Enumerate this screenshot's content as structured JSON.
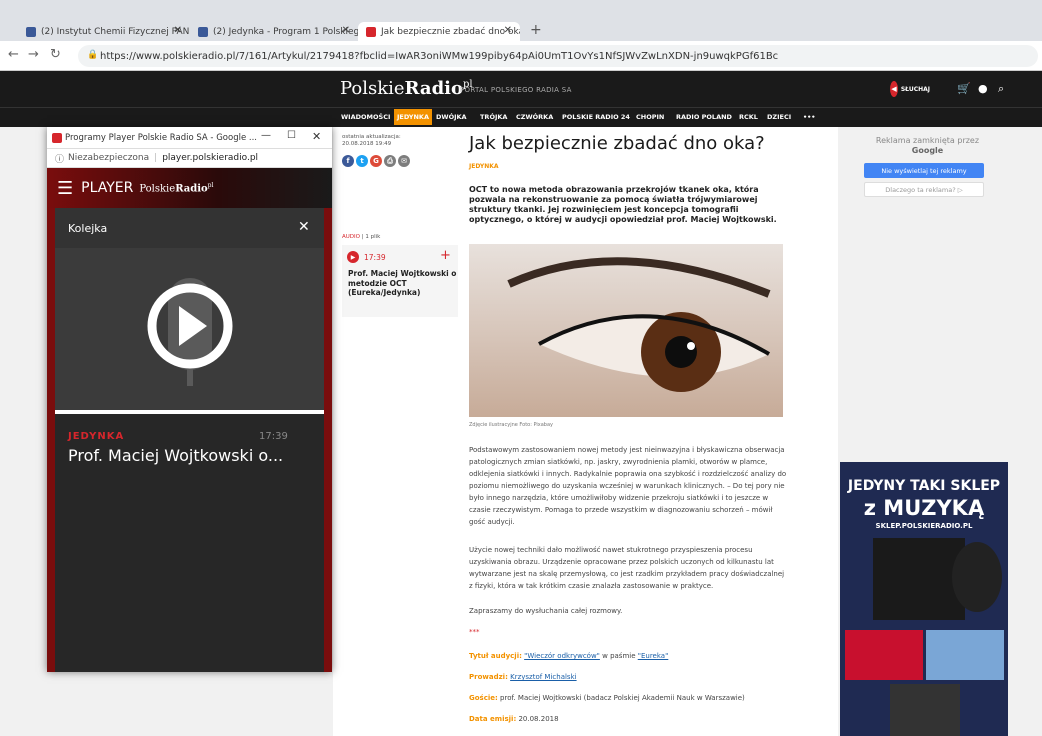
{
  "browser": {
    "tabs": [
      {
        "label": "(2) Instytut Chemii Fizycznej PAN",
        "favicon": "facebook-icon"
      },
      {
        "label": "(2) Jedynka - Program 1 Polskieg",
        "favicon": "facebook-icon"
      },
      {
        "label": "Jak bezpiecznie zbadać dno oka? ",
        "favicon": "polskieradio-icon"
      }
    ],
    "url": "https://www.polskieradio.pl/7/161/Artykul/2179418?fbclid=IwAR3oniWMw199piby64pAi0UmT1OvYs1NfSJWvZwLnXDN-jn9uwqkPGf61Bc"
  },
  "site": {
    "logo_a": "Polskie",
    "logo_b": "Radio",
    "logo_sup": "pl",
    "portal": "PORTAL POLSKIEGO RADIA SA",
    "listen": "SŁUCHAJ",
    "menu": [
      "WIADOMOŚCI",
      "JEDYNKA",
      "DWÓJKA",
      "TRÓJKA",
      "CZWÓRKA",
      "POLSKIE RADIO 24",
      "CHOPIN",
      "RADIO POLAND",
      "RCKL",
      "DZIECI",
      "•••"
    ]
  },
  "side": {
    "updated_label": "ostatnia aktualizacja:",
    "updated_date": "20.08.2018 19:49",
    "audio_label": "AUDIO",
    "files": "1 plik",
    "audio_time": "17:39",
    "audio_title": "Prof. Maciej Wojtkowski o metodzie OCT (Eureka/Jedynka)"
  },
  "article": {
    "title": "Jak bezpiecznie zbadać dno oka?",
    "category": "JEDYNKA",
    "lead": "OCT to nowa metoda obrazowania przekrojów tkanek oka, która pozwala na rekonstruowanie za pomocą światła trójwymiarowej struktury tkanki. Jej rozwinięciem jest koncepcja tomografii optycznego, o której w audycji opowiedział prof. Maciej Wojtkowski.",
    "caption": "Zdjęcie ilustracyjne   Foto: Pixabay",
    "p1": "Podstawowym zastosowaniem nowej metody jest nieinwazyjna i błyskawiczna obserwacja patologicznych zmian siatkówki, np. jaskry, zwyrodnienia plamki, otworów w plamce, odklejenia siatkówki i innych. Radykalnie poprawia ona szybkość i rozdzielczość analizy do poziomu niemożliwego do uzyskania wcześniej w warunkach klinicznych. – Do tej pory nie było innego narzędzia, które umożliwiłoby widzenie przekroju siatkówki i to jeszcze w czasie rzeczywistym. Pomaga to przede wszystkim w diagnozowaniu schorzeń – mówił gość audycji.",
    "p2": "Użycie nowej techniki dało możliwość nawet stukrotnego przyspieszenia procesu uzyskiwania obrazu. Urządzenie opracowane przez polskich uczonych od kilkunastu lat wytwarzane jest na skalę przemysłową, co jest rzadkim przykładem pracy doświadczalnej z fizyki, która w tak krótkim czasie znalazła zastosowanie w praktyce.",
    "p3": "Zapraszamy do wysłuchania całej rozmowy.",
    "stars": "***",
    "title_label": "Tytuł audycji:",
    "title_value": "\"Wieczór odkrywców\"",
    "series_mid": " w paśmie ",
    "series_value": "\"Eureka\"",
    "host_label": "Prowadzi:",
    "host_value": "Krzysztof Michalski",
    "guests_label": "Goście:",
    "guests_value": " prof. Maciej Wojtkowski (badacz Polskiej Akademii Nauk w Warszawie)",
    "date_label": "Data emisji:",
    "date_value": " 20.08.2018"
  },
  "ad": {
    "closed": "Reklama zamknięta przez",
    "google": "Google",
    "btn1": "Nie wyświetlaj tej reklamy",
    "btn2": "Dlaczego ta reklama? ▷",
    "sklep1": "JEDYNY TAKI SKLEP",
    "sklep2": "z MUZYKĄ",
    "sklep3": "SKLEP.POLSKIERADIO.PL"
  },
  "player": {
    "window_title": "Programy Player Polskie Radio SA - Google ...",
    "insecure": "Niezabezpieczona",
    "host": "player.polskieradio.pl",
    "brand": "PLAYER",
    "brand_a": "Polskie",
    "brand_b": "Radio",
    "brand_sup": "pl",
    "queue": "Kolejka",
    "station": "JEDYNKA",
    "time": "17:39",
    "track": "Prof. Maciej Wojtkowski o..."
  },
  "colors": {
    "accent": "#f39200",
    "brand_red": "#d6262c",
    "dark": "#1a1a1a"
  }
}
